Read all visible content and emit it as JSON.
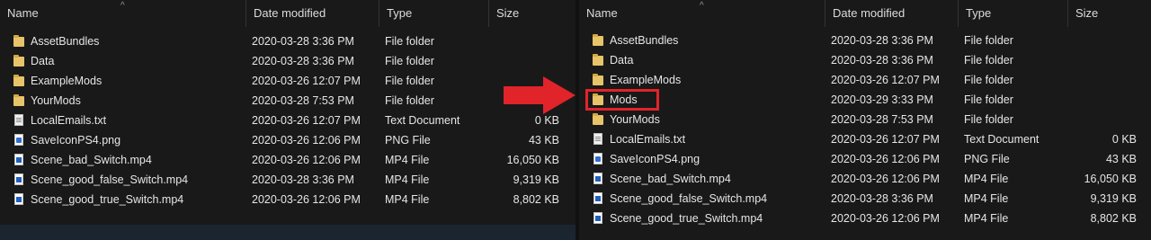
{
  "columns": {
    "name": "Name",
    "date": "Date modified",
    "type": "Type",
    "size": "Size"
  },
  "colors": {
    "highlight": "#e0242a",
    "folder": "#e7c46a",
    "background": "#191919"
  },
  "left_pane": {
    "files": [
      {
        "icon": "folder-icon",
        "name": "AssetBundles",
        "date": "2020-03-28 3:36 PM",
        "type": "File folder",
        "size": ""
      },
      {
        "icon": "folder-icon",
        "name": "Data",
        "date": "2020-03-28 3:36 PM",
        "type": "File folder",
        "size": ""
      },
      {
        "icon": "folder-icon",
        "name": "ExampleMods",
        "date": "2020-03-26 12:07 PM",
        "type": "File folder",
        "size": ""
      },
      {
        "icon": "folder-icon",
        "name": "YourMods",
        "date": "2020-03-28 7:53 PM",
        "type": "File folder",
        "size": ""
      },
      {
        "icon": "text-document-icon",
        "name": "LocalEmails.txt",
        "date": "2020-03-26 12:07 PM",
        "type": "Text Document",
        "size": "0 KB"
      },
      {
        "icon": "image-file-icon",
        "name": "SaveIconPS4.png",
        "date": "2020-03-26 12:06 PM",
        "type": "PNG File",
        "size": "43 KB"
      },
      {
        "icon": "video-file-icon",
        "name": "Scene_bad_Switch.mp4",
        "date": "2020-03-26 12:06 PM",
        "type": "MP4 File",
        "size": "16,050 KB"
      },
      {
        "icon": "video-file-icon",
        "name": "Scene_good_false_Switch.mp4",
        "date": "2020-03-28 3:36 PM",
        "type": "MP4 File",
        "size": "9,319 KB"
      },
      {
        "icon": "video-file-icon",
        "name": "Scene_good_true_Switch.mp4",
        "date": "2020-03-26 12:06 PM",
        "type": "MP4 File",
        "size": "8,802 KB"
      }
    ]
  },
  "right_pane": {
    "files": [
      {
        "icon": "folder-icon",
        "name": "AssetBundles",
        "date": "2020-03-28 3:36 PM",
        "type": "File folder",
        "size": ""
      },
      {
        "icon": "folder-icon",
        "name": "Data",
        "date": "2020-03-28 3:36 PM",
        "type": "File folder",
        "size": ""
      },
      {
        "icon": "folder-icon",
        "name": "ExampleMods",
        "date": "2020-03-26 12:07 PM",
        "type": "File folder",
        "size": ""
      },
      {
        "icon": "folder-icon",
        "name": "Mods",
        "date": "2020-03-29 3:33 PM",
        "type": "File folder",
        "size": "",
        "highlighted": true
      },
      {
        "icon": "folder-icon",
        "name": "YourMods",
        "date": "2020-03-28 7:53 PM",
        "type": "File folder",
        "size": ""
      },
      {
        "icon": "text-document-icon",
        "name": "LocalEmails.txt",
        "date": "2020-03-26 12:07 PM",
        "type": "Text Document",
        "size": "0 KB"
      },
      {
        "icon": "image-file-icon",
        "name": "SaveIconPS4.png",
        "date": "2020-03-26 12:06 PM",
        "type": "PNG File",
        "size": "43 KB"
      },
      {
        "icon": "video-file-icon",
        "name": "Scene_bad_Switch.mp4",
        "date": "2020-03-26 12:06 PM",
        "type": "MP4 File",
        "size": "16,050 KB"
      },
      {
        "icon": "video-file-icon",
        "name": "Scene_good_false_Switch.mp4",
        "date": "2020-03-28 3:36 PM",
        "type": "MP4 File",
        "size": "9,319 KB"
      },
      {
        "icon": "video-file-icon",
        "name": "Scene_good_true_Switch.mp4",
        "date": "2020-03-26 12:06 PM",
        "type": "MP4 File",
        "size": "8,802 KB"
      }
    ]
  }
}
